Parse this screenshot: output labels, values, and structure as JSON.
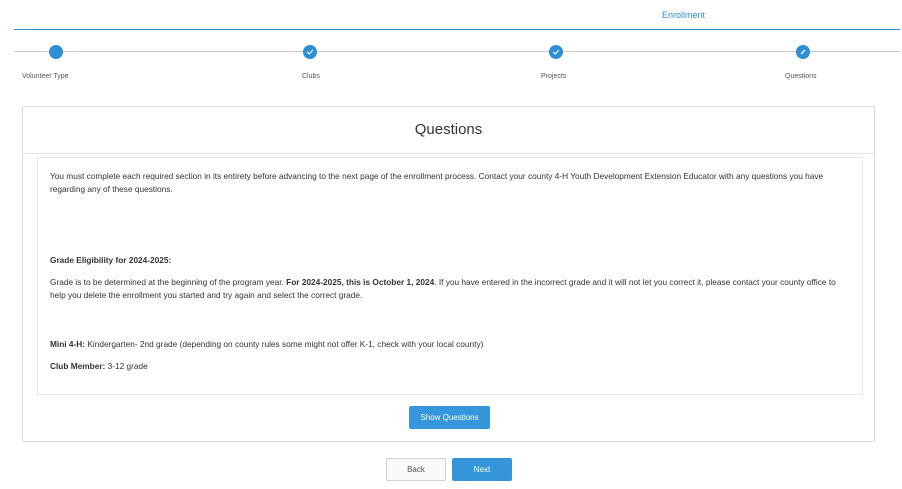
{
  "top_tab": {
    "label": "Enrollment"
  },
  "colors": {
    "accent": "#2f8fd6",
    "button": "#3596dc",
    "border": "#dcdcdc"
  },
  "stepper": {
    "steps": [
      {
        "label": "Volunteer Type",
        "icon": "filled-circle"
      },
      {
        "label": "Clubs",
        "icon": "check-icon"
      },
      {
        "label": "Projects",
        "icon": "check-icon"
      },
      {
        "label": "Questions",
        "icon": "pencil-icon"
      }
    ]
  },
  "card": {
    "title": "Questions",
    "intro": "You must complete each required section in its entirety before advancing to the next page of the enrollment process. Contact your county 4-H Youth Development Extension Educator with any questions you have regarding any of these questions.",
    "grade_heading": "Grade Eligibility for 2024-2025:",
    "grade_text_1": "Grade is to be determined at the beginning of the program year. ",
    "grade_text_bold": "For 2024-2025, this is October 1, 2024",
    "grade_text_2": ". If you have entered in the incorrect grade and it will not let you correct it, please contact your county office to help you delete the enrollment you started and try again and select the correct grade.",
    "mini_label": "Mini 4-H:",
    "mini_text": " Kindergarten- 2nd grade (depending on county rules some might not offer K-1, check with your local county)",
    "club_label": "Club Member:",
    "club_text": " 3-12 grade",
    "show_questions_label": "Show Questions"
  },
  "nav": {
    "back_label": "Back",
    "next_label": "Next"
  }
}
